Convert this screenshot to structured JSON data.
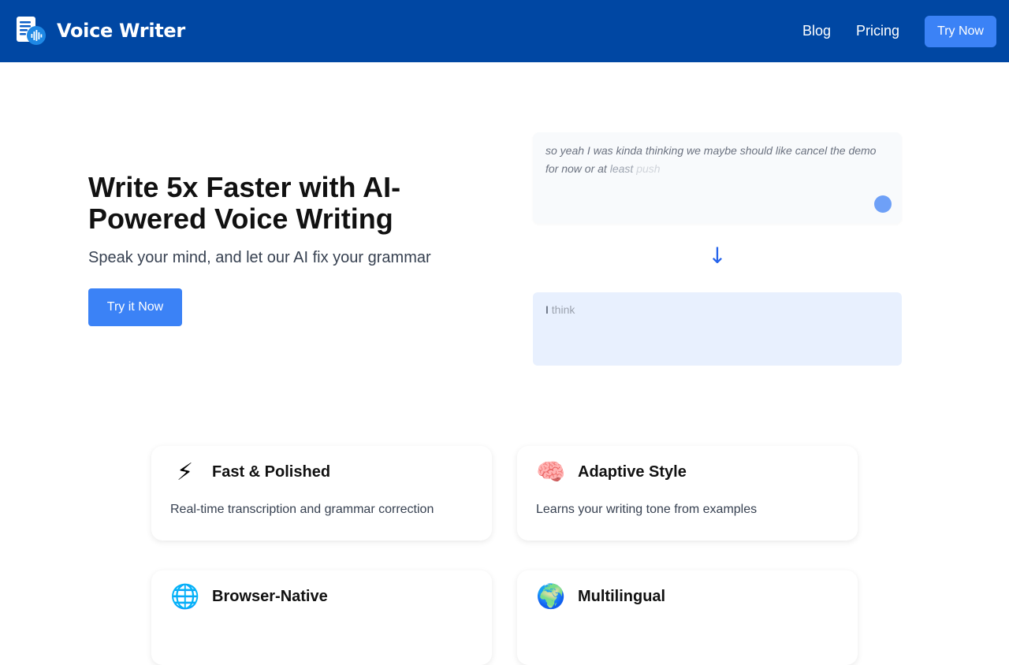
{
  "nav": {
    "brand": "Voice Writer",
    "links": [
      "Blog",
      "Pricing"
    ],
    "cta": "Try Now"
  },
  "hero": {
    "title": "Write 5x Faster with AI-Powered Voice Writing",
    "subtitle": "Speak your mind, and let our AI fix your grammar",
    "cta": "Try it Now"
  },
  "demo": {
    "input_text": "so yeah I was kinda thinking we maybe should like cancel the demo for now or at",
    "input_fade1": "least",
    "input_fade2": "push",
    "arrow": "↓",
    "output_text": "I",
    "output_fade": "think"
  },
  "features": [
    {
      "icon": "lightning-icon",
      "emoji": "⚡",
      "title": "Fast & Polished",
      "desc": "Real-time transcription and grammar correction"
    },
    {
      "icon": "brain-icon",
      "emoji": "🧠",
      "title": "Adaptive Style",
      "desc": "Learns your writing tone from examples"
    },
    {
      "icon": "globe-icon",
      "emoji": "🌐",
      "title": "Browser-Native",
      "desc": ""
    },
    {
      "icon": "earth-icon",
      "emoji": "🌍",
      "title": "Multilingual",
      "desc": ""
    }
  ],
  "colors": {
    "nav_bg": "#0047a3",
    "accent": "#3b82f6",
    "output_bg": "#e8f0fe"
  }
}
